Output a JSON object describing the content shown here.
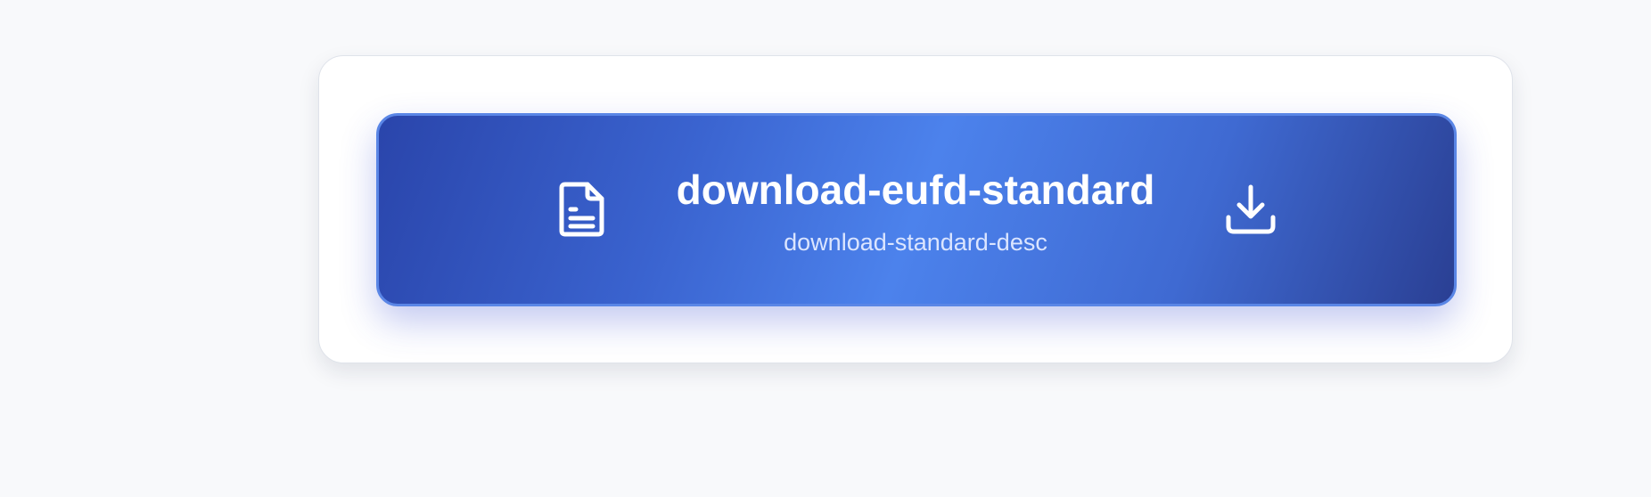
{
  "download_button": {
    "title": "download-eufd-standard",
    "description": "download-standard-desc",
    "leading_icon": "file-text-icon",
    "trailing_icon": "download-icon"
  },
  "colors": {
    "page_background": "#f8f9fb",
    "card_background": "#ffffff",
    "button_gradient": [
      "#2a45ab",
      "#4c82ec",
      "#2a3f93"
    ],
    "button_border": "#5a86e6",
    "title_text": "#ffffff",
    "description_text": "#dbe5ff"
  }
}
